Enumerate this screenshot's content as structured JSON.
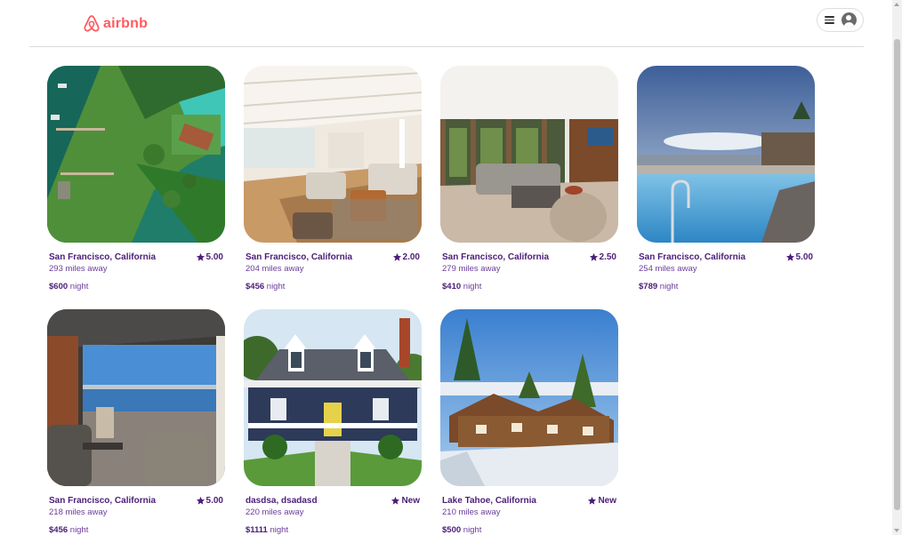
{
  "brand": {
    "name": "airbnb",
    "color": "#ff5a5f"
  },
  "user_menu": {
    "menu_icon": "hamburger-icon",
    "avatar_icon": "user-avatar-icon"
  },
  "theme": {
    "text_primary": "#4b1d78",
    "text_secondary": "#6a3d9a"
  },
  "listings": [
    {
      "location": "San Francisco, California",
      "rating": "5.00",
      "distance": "293 miles away",
      "price": "$600",
      "unit": "night",
      "image": "lakeside-aerial"
    },
    {
      "location": "San Francisco, California",
      "rating": "2.00",
      "distance": "204 miles away",
      "price": "$456",
      "unit": "night",
      "image": "bright-living-room"
    },
    {
      "location": "San Francisco, California",
      "rating": "2.50",
      "distance": "279 miles away",
      "price": "$410",
      "unit": "night",
      "image": "modern-living-room"
    },
    {
      "location": "San Francisco, California",
      "rating": "5.00",
      "distance": "254 miles away",
      "price": "$789",
      "unit": "night",
      "image": "resort-pool"
    },
    {
      "location": "San Francisco, California",
      "rating": "5.00",
      "distance": "218 miles away",
      "price": "$456",
      "unit": "night",
      "image": "lake-view-porch"
    },
    {
      "location": "dasdsa, dsadasd",
      "rating": "New",
      "distance": "220 miles away",
      "price": "$1111",
      "unit": "night",
      "image": "navy-house"
    },
    {
      "location": "Lake Tahoe, California",
      "rating": "New",
      "distance": "210 miles away",
      "price": "$500",
      "unit": "night",
      "image": "log-cabin"
    }
  ]
}
